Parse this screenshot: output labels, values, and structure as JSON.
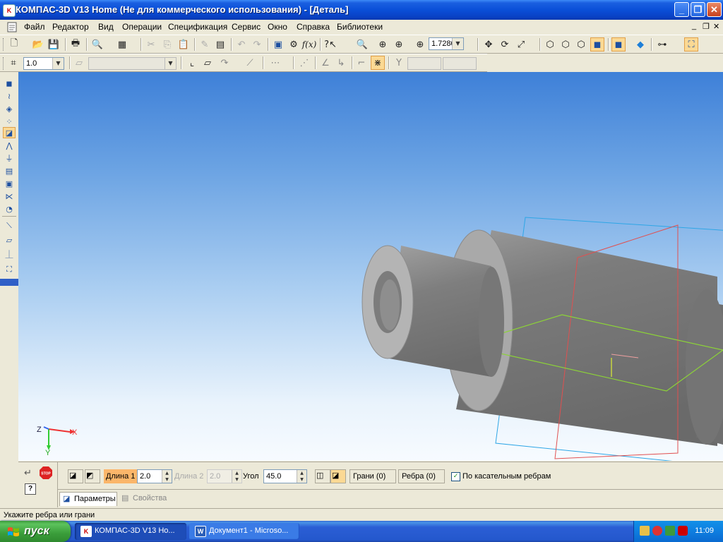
{
  "window": {
    "title": "КОМПАС-3D V13 Home (Не для коммерческого использования) - [Деталь]",
    "app_icon_text": "K"
  },
  "menu": {
    "items": [
      "Файл",
      "Редактор",
      "Вид",
      "Операции",
      "Спецификация",
      "Сервис",
      "Окно",
      "Справка",
      "Библиотеки"
    ]
  },
  "toolbar_main": {
    "zoom_value": "1.7280"
  },
  "toolbar_second": {
    "step_value": "1.0",
    "style_value": ""
  },
  "viewport": {
    "axis_labels": {
      "x": "X",
      "y": "Y",
      "z": "Z"
    },
    "background_top": "#3e80d8",
    "background_bottom": "#f7fbff",
    "plane_colors": {
      "xy": "#2ea6e6",
      "zy": "#e05050",
      "zx": "#8cd238"
    }
  },
  "property_panel": {
    "stop_label": "STOP",
    "length1_label": "Длина 1",
    "length1_value": "2.0",
    "length2_label": "Длина 2",
    "length2_value": "2.0",
    "angle_label": "Угол",
    "angle_value": "45.0",
    "faces_label": "Грани (0)",
    "edges_label": "Ребра (0)",
    "tangent_label": "По касательным ребрам",
    "tangent_checked": true,
    "tabs": [
      "Параметры",
      "Свойства"
    ]
  },
  "status": {
    "text": "Укажите ребра или грани"
  },
  "taskbar": {
    "start_label": "пуск",
    "tasks": [
      "КОМПАС-3D V13 Ho...",
      "Документ1 - Microso..."
    ],
    "clock": "11:09"
  }
}
